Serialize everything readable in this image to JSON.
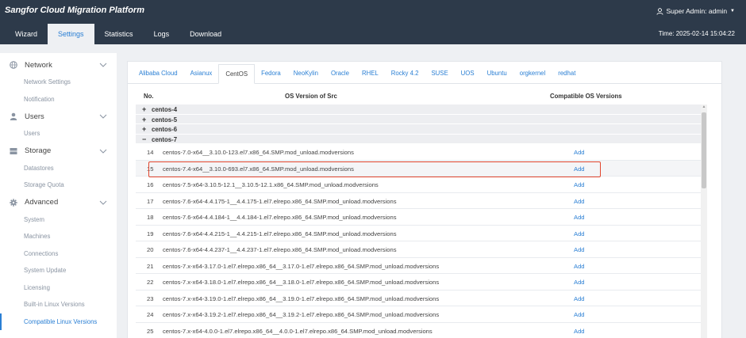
{
  "app": {
    "title": "Sangfor Cloud Migration Platform",
    "user": "Super Admin: admin"
  },
  "nav": {
    "tabs": [
      "Wizard",
      "Settings",
      "Statistics",
      "Logs",
      "Download"
    ],
    "active": 1
  },
  "time": "Time: 2025-02-14 15:04:22",
  "sidebar": {
    "network": {
      "label": "Network",
      "items": [
        "Network Settings",
        "Notification"
      ]
    },
    "users": {
      "label": "Users",
      "items": [
        "Users"
      ]
    },
    "storage": {
      "label": "Storage",
      "items": [
        "Datastores",
        "Storage Quota"
      ]
    },
    "advanced": {
      "label": "Advanced",
      "items": [
        "System",
        "Machines",
        "Connections",
        "System Update",
        "Licensing",
        "Built-in Linux Versions",
        "Compatible Linux Versions"
      ]
    }
  },
  "os_tabs": [
    "Alibaba Cloud",
    "Asianux",
    "CentOS",
    "Fedora",
    "NeoKylin",
    "Oracle",
    "RHEL",
    "Rocky 4.2",
    "SUSE",
    "UOS",
    "Ubuntu",
    "orgkernel",
    "redhat"
  ],
  "active_os_tab": 2,
  "table": {
    "headers": {
      "no": "No.",
      "os": "OS Version of Src",
      "compat": "Compatible OS Versions"
    },
    "groups": [
      {
        "sign": "+",
        "name": "centos-4"
      },
      {
        "sign": "+",
        "name": "centos-5"
      },
      {
        "sign": "+",
        "name": "centos-6"
      },
      {
        "sign": "−",
        "name": "centos-7"
      }
    ],
    "add_label": "Add",
    "rows": [
      {
        "no": "14",
        "os": "centos-7.0-x64__3.10.0-123.el7.x86_64.SMP.mod_unload.modversions"
      },
      {
        "no": "15",
        "os": "centos-7.4-x64__3.10.0-693.el7.x86_64.SMP.mod_unload.modversions"
      },
      {
        "no": "16",
        "os": "centos-7.5-x64-3.10.5-12.1__3.10.5-12.1.x86_64.SMP.mod_unload.modversions"
      },
      {
        "no": "17",
        "os": "centos-7.6-x64-4.4.175-1__4.4.175-1.el7.elrepo.x86_64.SMP.mod_unload.modversions"
      },
      {
        "no": "18",
        "os": "centos-7.6-x64-4.4.184-1__4.4.184-1.el7.elrepo.x86_64.SMP.mod_unload.modversions"
      },
      {
        "no": "19",
        "os": "centos-7.6-x64-4.4.215-1__4.4.215-1.el7.elrepo.x86_64.SMP.mod_unload.modversions"
      },
      {
        "no": "20",
        "os": "centos-7.6-x64-4.4.237-1__4.4.237-1.el7.elrepo.x86_64.SMP.mod_unload.modversions"
      },
      {
        "no": "21",
        "os": "centos-7.x-x64-3.17.0-1.el7.elrepo.x86_64__3.17.0-1.el7.elrepo.x86_64.SMP.mod_unload.modversions"
      },
      {
        "no": "22",
        "os": "centos-7.x-x64-3.18.0-1.el7.elrepo.x86_64__3.18.0-1.el7.elrepo.x86_64.SMP.mod_unload.modversions"
      },
      {
        "no": "23",
        "os": "centos-7.x-x64-3.19.0-1.el7.elrepo.x86_64__3.19.0-1.el7.elrepo.x86_64.SMP.mod_unload.modversions"
      },
      {
        "no": "24",
        "os": "centos-7.x-x64-3.19.2-1.el7.elrepo.x86_64__3.19.2-1.el7.elrepo.x86_64.SMP.mod_unload.modversions"
      },
      {
        "no": "25",
        "os": "centos-7.x-x64-4.0.0-1.el7.elrepo.x86_64__4.0.0-1.el7.elrepo.x86_64.SMP.mod_unload.modversions"
      }
    ],
    "highlighted_row": 1
  },
  "colors": {
    "topbar": "#2d3a4a",
    "accent": "#2a7fd4",
    "highlight": "#e2462e"
  }
}
